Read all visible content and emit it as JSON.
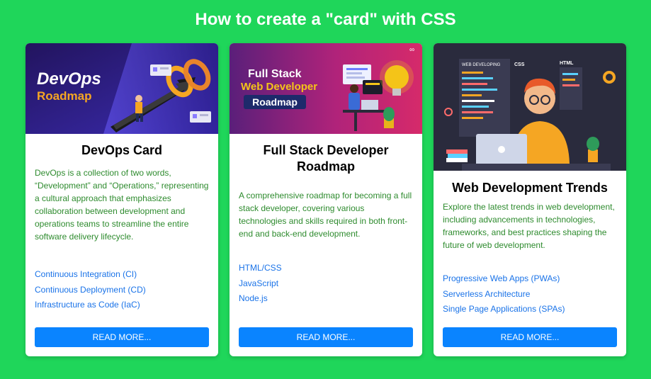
{
  "page": {
    "title": "How to create a \"card\" with CSS"
  },
  "colors": {
    "background": "#1fd65a",
    "card": "#ffffff",
    "description_text": "#2e8b2e",
    "link": "#1a73e8",
    "button": "#0a84ff"
  },
  "cards": [
    {
      "image": {
        "title_line1": "DevOps",
        "title_line2": "Roadmap"
      },
      "title": "DevOps Card",
      "description": "DevOps is a collection of two words, “Development” and “Operations,” representing a cultural approach that emphasizes collaboration between development and operations teams to streamline the entire software delivery lifecycle.",
      "links": [
        "Continuous Integration (CI)",
        "Continuous Deployment (CD)",
        "Infrastructure as Code (IaC)"
      ],
      "button_label": "READ MORE..."
    },
    {
      "image": {
        "title_line1": "Full Stack",
        "title_line2": "Web Developer",
        "badge": "Roadmap"
      },
      "title": "Full Stack Developer Roadmap",
      "description": "A comprehensive roadmap for becoming a full stack developer, covering various technologies and skills required in both front-end and back-end development.",
      "links": [
        "HTML/CSS",
        "JavaScript",
        "Node.js"
      ],
      "button_label": "READ MORE..."
    },
    {
      "image": {
        "panel_label": "WEB DEVELOPING",
        "tag_css": "CSS",
        "tag_html": "HTML"
      },
      "title": "Web Development Trends",
      "description": "Explore the latest trends in web development, including advancements in technologies, frameworks, and best practices shaping the future of web development.",
      "links": [
        "Progressive Web Apps (PWAs)",
        "Serverless Architecture",
        "Single Page Applications (SPAs)"
      ],
      "button_label": "READ MORE..."
    }
  ]
}
